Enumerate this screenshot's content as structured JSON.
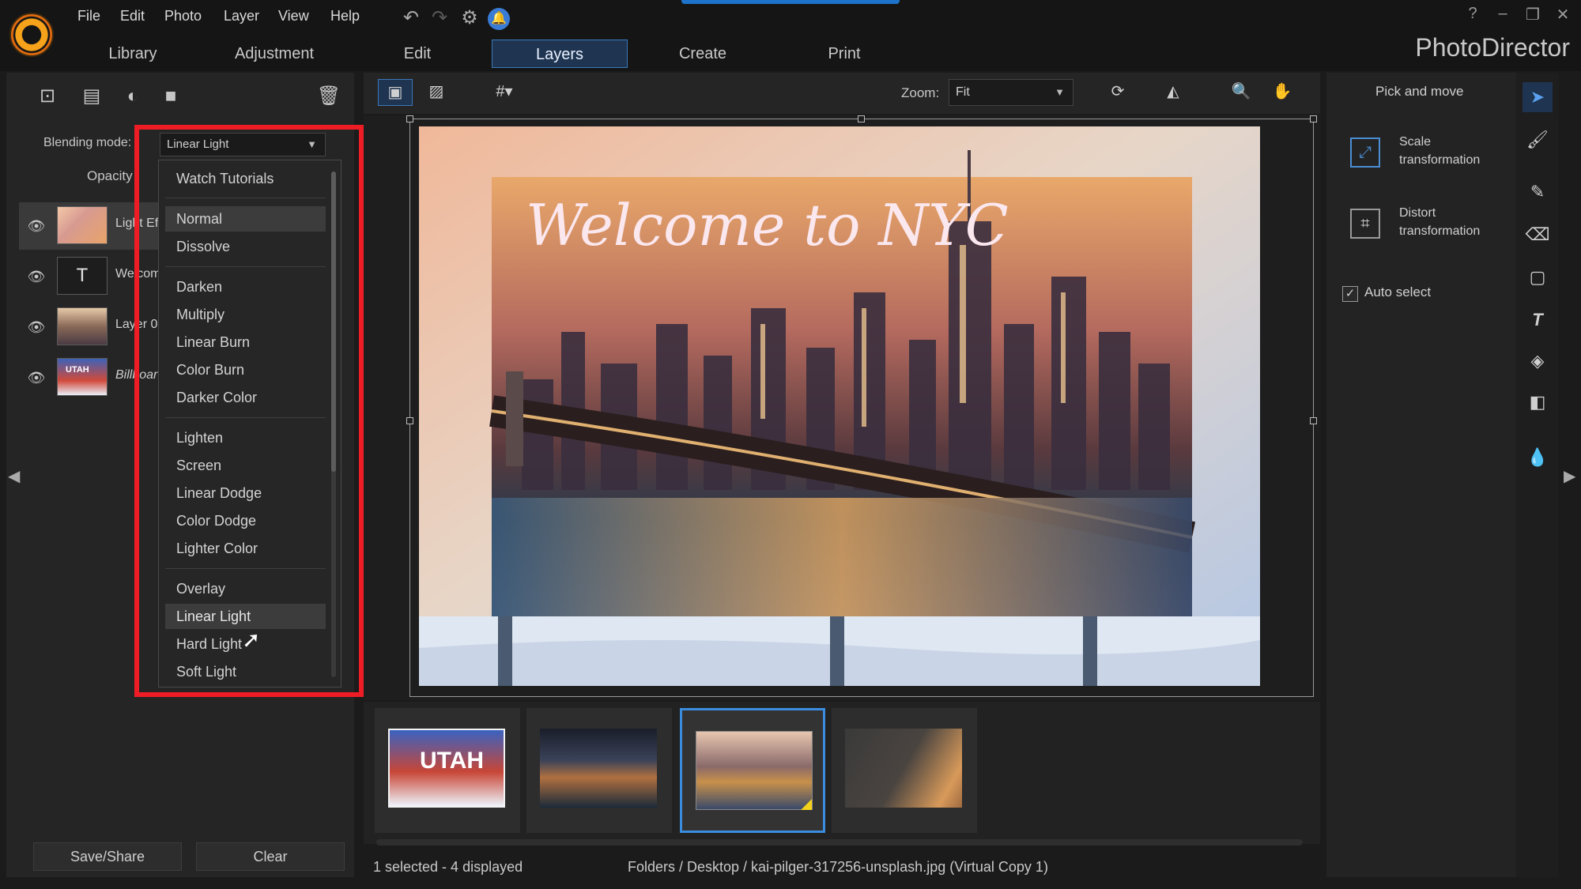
{
  "menu": {
    "items": [
      "File",
      "Edit",
      "Photo",
      "Layer",
      "View",
      "Help"
    ]
  },
  "modes": {
    "tabs": [
      "Library",
      "Adjustment",
      "Edit",
      "Layers",
      "Create",
      "Print"
    ],
    "active": "Layers"
  },
  "brand": "PhotoDirector",
  "window_controls": {
    "help": "?",
    "minimize": "–",
    "restore": "❐",
    "close": "✕"
  },
  "left_panel": {
    "blending_label": "Blending mode:",
    "blending_value": "Linear Light",
    "opacity_label": "Opacity",
    "layers": [
      {
        "name": "Light Ef",
        "icon": "eye-icon"
      },
      {
        "name": "Welcom",
        "icon": "eye-icon"
      },
      {
        "name": "Layer 0",
        "icon": "eye-icon"
      },
      {
        "name": "Billboar",
        "icon": "eye-icon"
      }
    ],
    "text_layer_glyph": "T",
    "utah_text": "UTAH",
    "save_share": "Save/Share",
    "clear": "Clear"
  },
  "blend_menu": {
    "watch_tutorials": "Watch Tutorials",
    "items": [
      "Normal",
      "Dissolve",
      "Darken",
      "Multiply",
      "Linear Burn",
      "Color Burn",
      "Darker Color",
      "Lighten",
      "Screen",
      "Linear Dodge",
      "Color Dodge",
      "Lighter Color",
      "Overlay",
      "Linear Light",
      "Hard Light",
      "Soft Light"
    ],
    "highlighted": [
      "Normal",
      "Linear Light"
    ]
  },
  "canvas_toolbar": {
    "zoom_label": "Zoom:",
    "zoom_value": "Fit"
  },
  "photo": {
    "headline": "Welcome to NYC"
  },
  "filmstrip": {
    "items": [
      "utah-billboard",
      "nyc-skyline-night",
      "nyc-skyline-selected",
      "light-effect"
    ],
    "selected_index": 2,
    "utah_text": "UTAH"
  },
  "status": {
    "selection": "1 selected - 4 displayed",
    "path": "Folders / Desktop / kai-pilger-317256-unsplash.jpg (Virtual Copy 1)"
  },
  "right_panel": {
    "pick_and_move": "Pick and move",
    "scale_line1": "Scale",
    "scale_line2": "transformation",
    "distort_line1": "Distort",
    "distort_line2": "transformation",
    "auto_select": "Auto select",
    "auto_select_checked": true
  },
  "colors": {
    "accent": "#3b78b8",
    "highlight_red": "#ee1c25",
    "logo_orange": "#f6a21a"
  }
}
